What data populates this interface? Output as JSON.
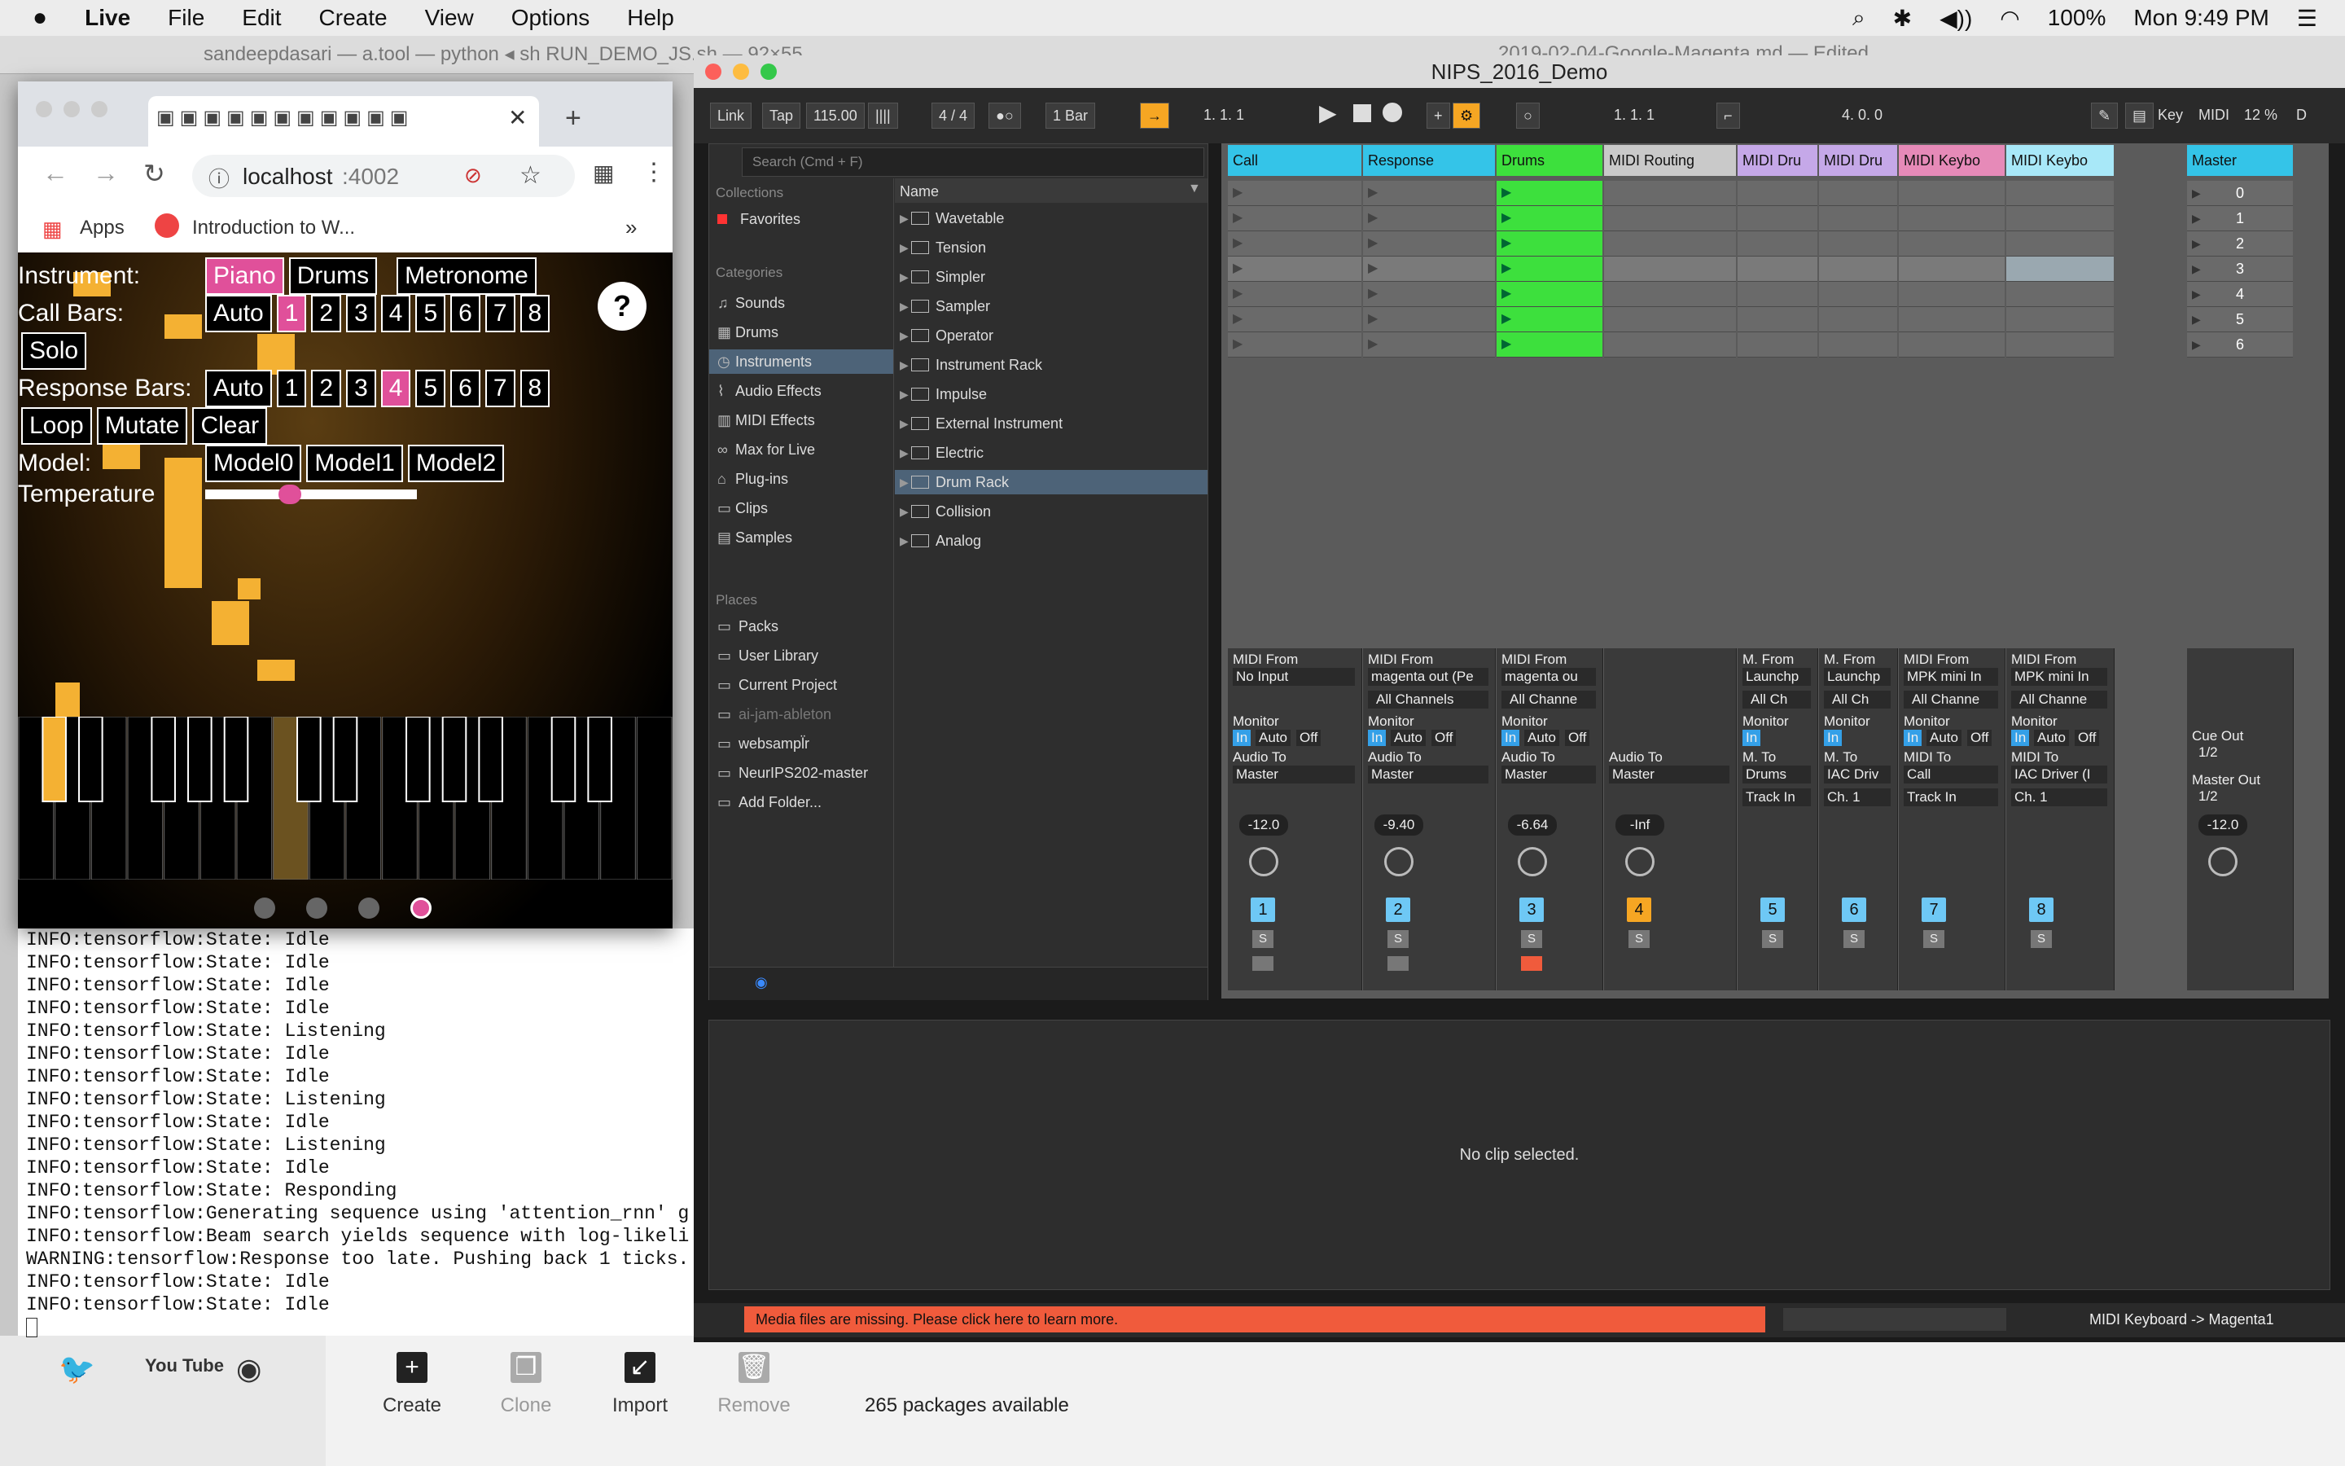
{
  "menubar": {
    "app": "Live",
    "items": [
      "File",
      "Edit",
      "Create",
      "View",
      "Options",
      "Help"
    ],
    "battery": "100%",
    "clock": "Mon 9:49 PM"
  },
  "background_windows": {
    "terminal_title": "sandeepdasari — a.tool — python ◂ sh RUN_DEMO_JS.sh — 92×55",
    "markdown_title": "2019-02-04-Google-Magenta.md — Edited"
  },
  "chrome": {
    "url": "localhost",
    "port": ":4002",
    "bookmarks": {
      "apps": "Apps",
      "intro": "Introduction to W..."
    }
  },
  "ajam": {
    "instrument": {
      "label": "Instrument:",
      "options": [
        "Piano",
        "Drums",
        "Metronome"
      ],
      "selected": "Piano"
    },
    "call_bars": {
      "label": "Call Bars:",
      "options": [
        "Auto",
        "1",
        "2",
        "3",
        "4",
        "5",
        "6",
        "7",
        "8"
      ],
      "selected": "1"
    },
    "solo": "Solo",
    "response_bars": {
      "label": "Response Bars:",
      "options": [
        "Auto",
        "1",
        "2",
        "3",
        "4",
        "5",
        "6",
        "7",
        "8"
      ],
      "selected": "4"
    },
    "actions": [
      "Loop",
      "Mutate",
      "Clear"
    ],
    "model": {
      "label": "Model:",
      "options": [
        "Model0",
        "Model1",
        "Model2"
      ]
    },
    "temperature": {
      "label": "Temperature",
      "value": 0.4
    },
    "help": "?",
    "page_dots": 4,
    "active_dot": 3
  },
  "terminal_lines": [
    "INFO:tensorflow:State: Idle",
    "INFO:tensorflow:State: Idle",
    "INFO:tensorflow:State: Idle",
    "INFO:tensorflow:State: Idle",
    "INFO:tensorflow:State: Listening",
    "INFO:tensorflow:State: Idle",
    "INFO:tensorflow:State: Idle",
    "INFO:tensorflow:State: Listening",
    "INFO:tensorflow:State: Idle",
    "INFO:tensorflow:State: Listening",
    "INFO:tensorflow:State: Idle",
    "INFO:tensorflow:State: Responding",
    "INFO:tensorflow:Generating sequence using 'attention_rnn' g",
    "INFO:tensorflow:Beam search yields sequence with log-likeli",
    "WARNING:tensorflow:Response too late. Pushing back 1 ticks.",
    "INFO:tensorflow:State: Idle",
    "INFO:tensorflow:State: Idle"
  ],
  "anaconda": {
    "buttons": [
      "Create",
      "Clone",
      "Import",
      "Remove"
    ],
    "packages": "265 packages available"
  },
  "ableton": {
    "title": "NIPS_2016_Demo",
    "control_bar": {
      "link": "Link",
      "tap": "Tap",
      "tempo": "115.00",
      "signature": "4 / 4",
      "quantize": "1 Bar",
      "position": "1.  1.  1",
      "loop_start": "1.  1.  1",
      "loop_length": "4.  0.  0",
      "key": "Key",
      "midi": "MIDI",
      "cpu": "12 %",
      "d": "D"
    },
    "browser": {
      "search_placeholder": "Search (Cmd + F)",
      "collections_header": "Collections",
      "favorites": "Favorites",
      "categories_header": "Categories",
      "categories": [
        "Sounds",
        "Drums",
        "Instruments",
        "Audio Effects",
        "MIDI Effects",
        "Max for Live",
        "Plug-ins",
        "Clips",
        "Samples"
      ],
      "selected_category": "Instruments",
      "places_header": "Places",
      "places": [
        "Packs",
        "User Library",
        "Current Project",
        "ai-jam-ableton",
        "websampl̈r",
        "NeurIPS202-master",
        "Add Folder..."
      ],
      "name_header": "Name",
      "names": [
        "Wavetable",
        "Tension",
        "Simpler",
        "Sampler",
        "Operator",
        "Instrument Rack",
        "Impulse",
        "External Instrument",
        "Electric",
        "Drum Rack",
        "Collision",
        "Analog"
      ],
      "selected_name": "Drum Rack"
    },
    "tracks": [
      {
        "name": "Call",
        "color": "#34c4e8",
        "midi_from": "No Input",
        "channel": "",
        "audio_to": "Master",
        "vol": "-12.0",
        "num": "1"
      },
      {
        "name": "Response",
        "color": "#34c4e8",
        "midi_from": "magenta out (Pe",
        "channel": "All Channels",
        "audio_to": "Master",
        "vol": "-9.40",
        "num": "2"
      },
      {
        "name": "Drums",
        "color": "#3de03d",
        "midi_from": "magenta ou",
        "channel": "All Channe",
        "audio_to": "Master",
        "vol": "-6.64",
        "num": "3"
      },
      {
        "name": "MIDI Routing",
        "color": "#c9c9c9",
        "midi_from": "",
        "channel": "",
        "audio_to": "Master",
        "vol": "-Inf",
        "num": "4"
      },
      {
        "name": "MIDI Dru",
        "color": "#c5a8e8",
        "midi_from": "Launchp",
        "channel": "All Ch",
        "audio_to": "Drums",
        "vol": "",
        "num": "5"
      },
      {
        "name": "MIDI Dru",
        "color": "#c5a8e8",
        "midi_from": "Launchp",
        "channel": "All Ch",
        "audio_to": "IAC Driv",
        "vol": "",
        "num": "6"
      },
      {
        "name": "MIDI Keybo",
        "color": "#e68ab8",
        "midi_from": "MPK mini In",
        "channel": "All Channe",
        "audio_to": "Call",
        "vol": "",
        "num": "7"
      },
      {
        "name": "MIDI Keybo",
        "color": "#a8e8f8",
        "midi_from": "MPK mini In",
        "channel": "All Channe",
        "audio_to": "IAC Driver (I",
        "vol": "",
        "num": "8"
      }
    ],
    "master": {
      "name": "Master",
      "scenes": [
        "0",
        "1",
        "2",
        "3",
        "4",
        "5",
        "6"
      ],
      "cue_out": "Cue Out",
      "cue_val": "1/2",
      "master_out": "Master Out",
      "master_val": "1/2",
      "vol": "-12.0"
    },
    "mixer_labels": {
      "midi_from": "MIDI From",
      "monitor": "Monitor",
      "in": "In",
      "auto": "Auto",
      "off": "Off",
      "audio_to": "Audio To",
      "m_from": "M. From",
      "m_to": "M. To",
      "midi_to": "MIDI To",
      "track_in": "Track In",
      "ch1": "Ch. 1",
      "s": "S"
    },
    "detail": "No clip selected.",
    "status_missing": "Media files are missing. Please click here to learn more.",
    "status_midi": "MIDI Keyboard -> Magenta1"
  }
}
